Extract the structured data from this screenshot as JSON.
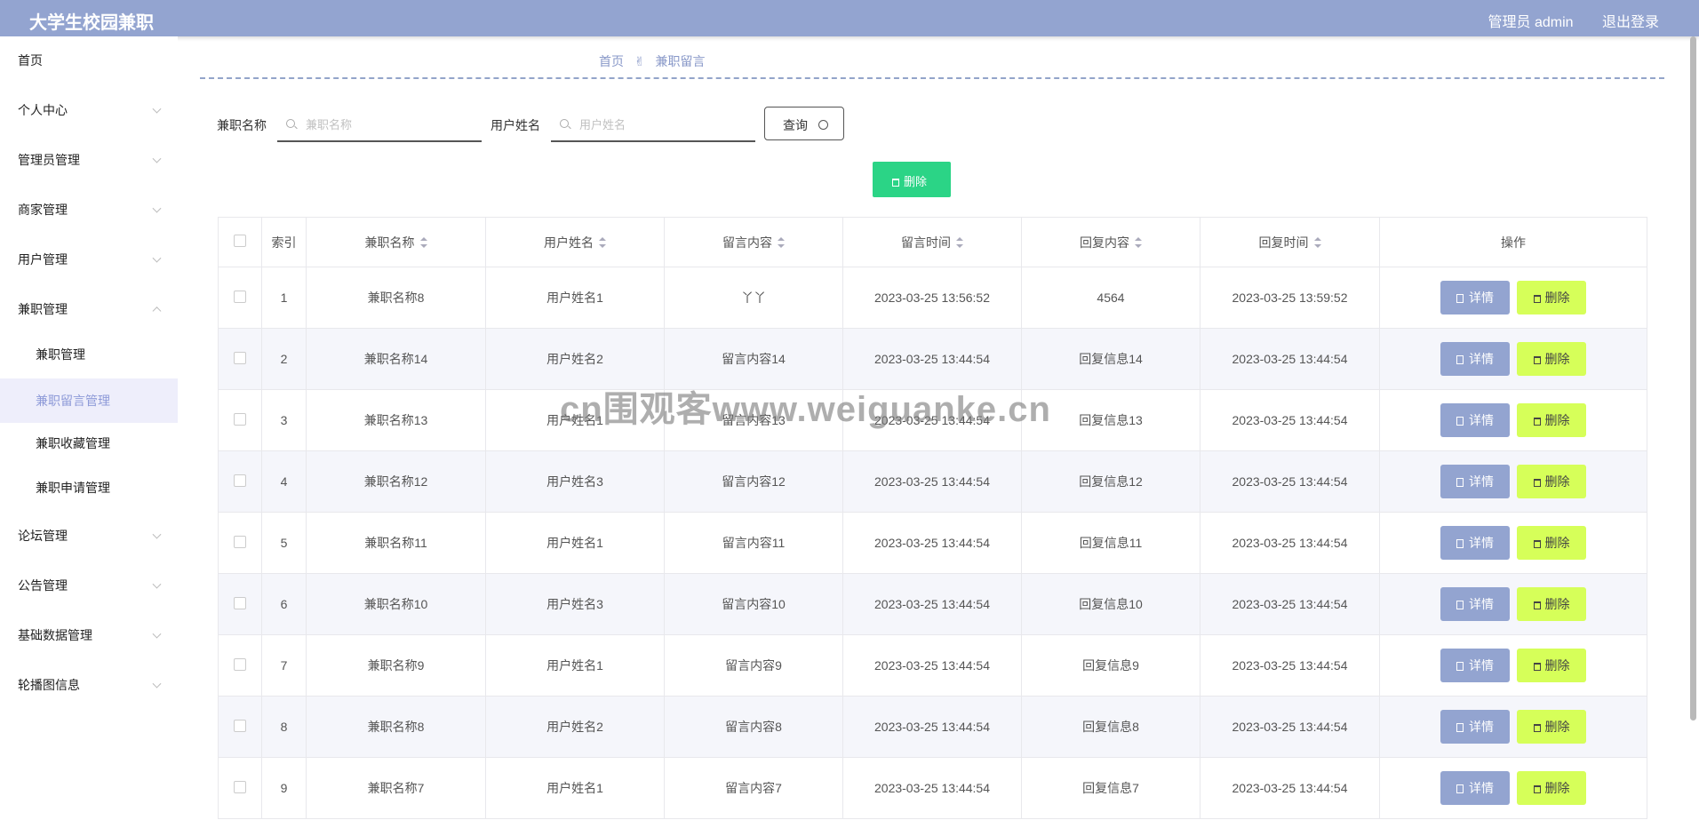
{
  "header": {
    "title": "大学生校园兼职",
    "admin_label": "管理员 admin",
    "logout_label": "退出登录"
  },
  "sidebar": {
    "items": [
      {
        "label": "首页",
        "chevron": false
      },
      {
        "label": "个人中心",
        "chevron": true
      },
      {
        "label": "管理员管理",
        "chevron": true
      },
      {
        "label": "商家管理",
        "chevron": true
      },
      {
        "label": "用户管理",
        "chevron": true
      },
      {
        "label": "兼职管理",
        "chevron": true,
        "expanded": true
      },
      {
        "label": "论坛管理",
        "chevron": true
      },
      {
        "label": "公告管理",
        "chevron": true
      },
      {
        "label": "基础数据管理",
        "chevron": true
      },
      {
        "label": "轮播图信息",
        "chevron": true
      }
    ],
    "subitems": [
      {
        "label": "兼职管理",
        "active": false
      },
      {
        "label": "兼职留言管理",
        "active": true
      },
      {
        "label": "兼职收藏管理",
        "active": false
      },
      {
        "label": "兼职申请管理",
        "active": false
      }
    ]
  },
  "breadcrumb": {
    "home": "首页",
    "hand_icon": "✌",
    "current": "兼职留言"
  },
  "search": {
    "field1_label": "兼职名称",
    "field1_placeholder": "兼职名称",
    "field1_value": "",
    "field2_label": "用户姓名",
    "field2_placeholder": "用户姓名",
    "field2_value": "",
    "query_label": "查询"
  },
  "toolbar": {
    "delete_label": "删除"
  },
  "table": {
    "columns": [
      "索引",
      "兼职名称",
      "用户姓名",
      "留言内容",
      "留言时间",
      "回复内容",
      "回复时间",
      "操作"
    ],
    "detail_label": "详情",
    "delete_label": "删除",
    "rows": [
      [
        "1",
        "兼职名称8",
        "用户姓名1",
        "丫丫",
        "2023-03-25 13:56:52",
        "4564",
        "2023-03-25 13:59:52"
      ],
      [
        "2",
        "兼职名称14",
        "用户姓名2",
        "留言内容14",
        "2023-03-25 13:44:54",
        "回复信息14",
        "2023-03-25 13:44:54"
      ],
      [
        "3",
        "兼职名称13",
        "用户姓名1",
        "留言内容13",
        "2023-03-25 13:44:54",
        "回复信息13",
        "2023-03-25 13:44:54"
      ],
      [
        "4",
        "兼职名称12",
        "用户姓名3",
        "留言内容12",
        "2023-03-25 13:44:54",
        "回复信息12",
        "2023-03-25 13:44:54"
      ],
      [
        "5",
        "兼职名称11",
        "用户姓名1",
        "留言内容11",
        "2023-03-25 13:44:54",
        "回复信息11",
        "2023-03-25 13:44:54"
      ],
      [
        "6",
        "兼职名称10",
        "用户姓名3",
        "留言内容10",
        "2023-03-25 13:44:54",
        "回复信息10",
        "2023-03-25 13:44:54"
      ],
      [
        "7",
        "兼职名称9",
        "用户姓名1",
        "留言内容9",
        "2023-03-25 13:44:54",
        "回复信息9",
        "2023-03-25 13:44:54"
      ],
      [
        "8",
        "兼职名称8",
        "用户姓名2",
        "留言内容8",
        "2023-03-25 13:44:54",
        "回复信息8",
        "2023-03-25 13:44:54"
      ],
      [
        "9",
        "兼职名称7",
        "用户姓名1",
        "留言内容7",
        "2023-03-25 13:44:54",
        "回复信息7",
        "2023-03-25 13:44:54"
      ]
    ]
  },
  "watermark": "cn围观客www.weiguanke.cn",
  "colors": {
    "header": "#93a4d0",
    "accent_green": "#2bd486",
    "detail_button": "#93a4d0",
    "delete_button": "#d6ff59"
  }
}
